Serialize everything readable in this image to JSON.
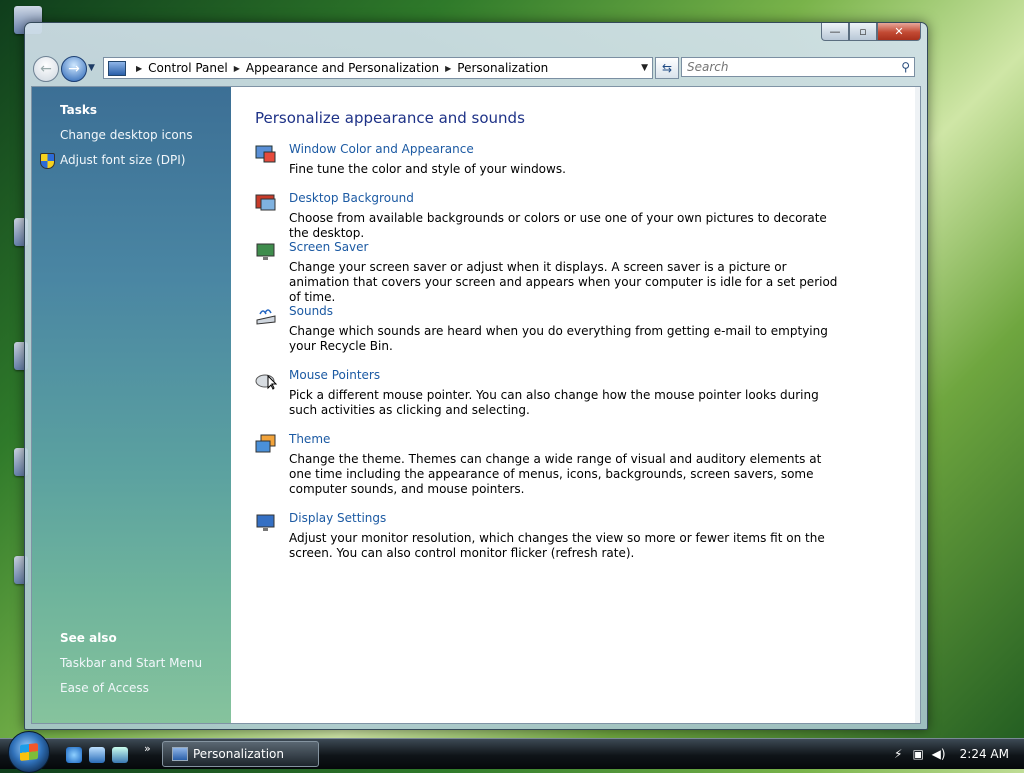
{
  "window": {
    "title": "Personalization",
    "controls": {
      "minimize": "—",
      "maximize": "▫",
      "close": "✕"
    }
  },
  "navigation": {
    "breadcrumb": [
      "Control Panel",
      "Appearance and Personalization",
      "Personalization"
    ],
    "separator": "▶",
    "search_placeholder": "Search"
  },
  "sidebar": {
    "tasks_heading": "Tasks",
    "tasks": [
      "Change desktop icons",
      "Adjust font size (DPI)"
    ],
    "see_also_heading": "See also",
    "see_also": [
      "Taskbar and Start Menu",
      "Ease of Access"
    ]
  },
  "main": {
    "heading": "Personalize appearance and sounds",
    "items": [
      {
        "title": "Window Color and Appearance",
        "desc": "Fine tune the color and style of your windows."
      },
      {
        "title": "Desktop Background",
        "desc": "Choose from available backgrounds or colors or use one of your own pictures to decorate the desktop."
      },
      {
        "title": "Screen Saver",
        "desc": "Change your screen saver or adjust when it displays. A screen saver is a picture or animation that covers your screen and appears when your computer is idle for a set period of time."
      },
      {
        "title": "Sounds",
        "desc": "Change which sounds are heard when you do everything from getting e-mail to emptying your Recycle Bin."
      },
      {
        "title": "Mouse Pointers",
        "desc": "Pick a different mouse pointer. You can also change how the mouse pointer looks during such activities as clicking and selecting."
      },
      {
        "title": "Theme",
        "desc": "Change the theme. Themes can change a wide range of visual and auditory elements at one time including the appearance of menus, icons, backgrounds, screen savers, some computer sounds, and mouse pointers."
      },
      {
        "title": "Display Settings",
        "desc": "Adjust your monitor resolution, which changes the view so more or fewer items fit on the screen. You can also control monitor flicker (refresh rate)."
      }
    ]
  },
  "taskbar": {
    "task_label": "Personalization",
    "more_arrow": "»",
    "clock": "2:24 AM"
  }
}
